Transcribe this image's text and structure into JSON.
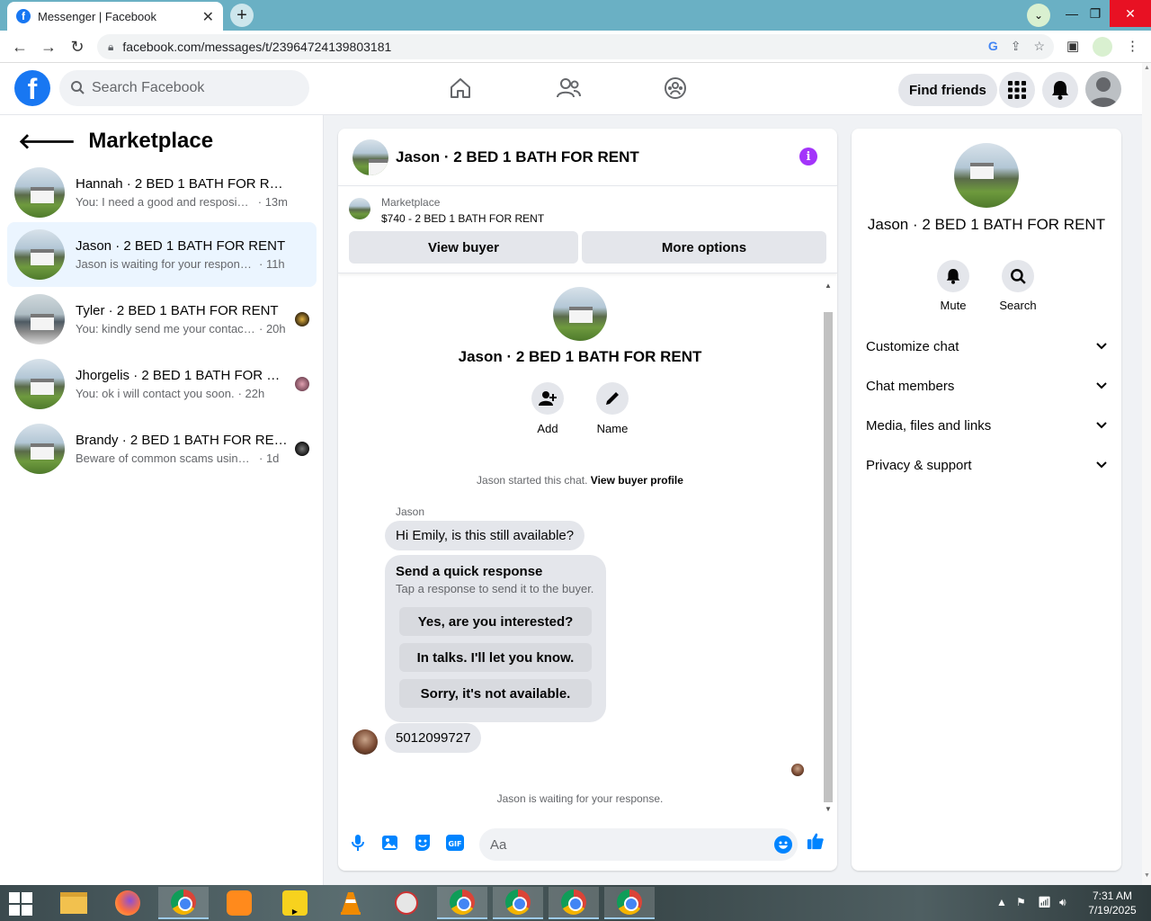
{
  "browser": {
    "tab_title": "Messenger | Facebook",
    "url": "facebook.com/messages/t/23964724139803181"
  },
  "header": {
    "search_placeholder": "Search Facebook",
    "find_friends": "Find friends"
  },
  "sidebar": {
    "title": "Marketplace",
    "conversations": [
      {
        "name": "Hannah · 2 BED 1 BATH FOR RENT",
        "preview": "You: I need a good and resposible t...",
        "time": "· 13m"
      },
      {
        "name": "Jason · 2 BED 1 BATH FOR RENT",
        "preview": "Jason is waiting for your response.",
        "time": "· 11h"
      },
      {
        "name": "Tyler · 2 BED 1 BATH FOR RENT",
        "preview": "You: kindly send me your contact ...",
        "time": "· 20h"
      },
      {
        "name": "Jhorgelis · 2 BED 1 BATH FOR RE...",
        "preview": "You: ok i will contact you soon.",
        "time": "· 22h"
      },
      {
        "name": "Brandy · 2 BED 1 BATH FOR RENT",
        "preview": "Beware of common scams using p...",
        "time": "· 1d"
      }
    ]
  },
  "chat": {
    "title": "Jason · 2 BED 1 BATH FOR RENT",
    "marketplace_label": "Marketplace",
    "listing": "$740 - 2 BED 1 BATH FOR RENT",
    "view_buyer": "View buyer",
    "more_options": "More options",
    "profile_name": "Jason · 2 BED 1 BATH FOR RENT",
    "add_label": "Add",
    "name_label": "Name",
    "started_text": "Jason started this chat.",
    "view_buyer_profile": "View buyer profile",
    "sender": "Jason",
    "message1": "Hi Emily, is this still available?",
    "quick_title": "Send a quick response",
    "quick_sub": "Tap a response to send it to the buyer.",
    "quick_responses": [
      "Yes, are you interested?",
      "In talks. I'll let you know.",
      "Sorry, it's not available."
    ],
    "message2": "5012099727",
    "waiting": "Jason is waiting for your response.",
    "composer_placeholder": "Aa"
  },
  "details": {
    "name": "Jason · 2 BED 1 BATH FOR RENT",
    "mute": "Mute",
    "search": "Search",
    "sections": [
      "Customize chat",
      "Chat members",
      "Media, files and links",
      "Privacy & support"
    ]
  },
  "taskbar": {
    "time": "7:31 AM",
    "date": "7/19/2025"
  },
  "colors": {
    "fb_blue": "#1877f2",
    "active_conv": "#ebf5ff",
    "info_purple": "#a334fa",
    "messenger_blue": "#0084ff"
  }
}
